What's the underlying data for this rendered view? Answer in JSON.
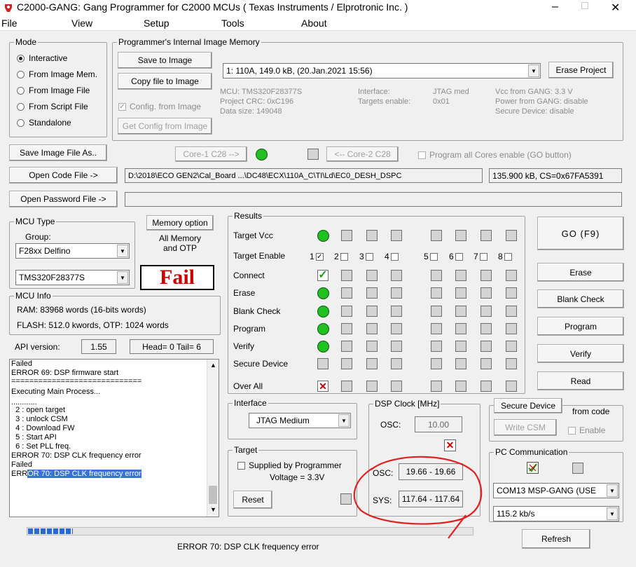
{
  "window": {
    "title": "C2000-GANG:  Gang Programmer for C2000  MCUs ( Texas Instruments / Elprotronic Inc. )",
    "min": "–",
    "max": "□",
    "close": "✕"
  },
  "menu": [
    "File",
    "View",
    "Setup",
    "Tools",
    "About"
  ],
  "mode": {
    "legend": "Mode",
    "options": [
      "Interactive",
      "From Image Mem.",
      "From Image File",
      "From Script File",
      "Standalone"
    ],
    "selected": 0
  },
  "image_memory": {
    "legend": "Programmer's Internal Image Memory",
    "save_to_image": "Save to Image",
    "copy_file": "Copy file to Image",
    "config_from_image": "Config. from Image",
    "get_config": "Get Config from Image",
    "selected_image": "1: 110A, 149.0 kB,  (20.Jan.2021  15:56)",
    "erase_project": "Erase Project",
    "info": [
      [
        "MCU:  TMS320F28377S",
        "Interface:",
        "JTAG med",
        "Vcc from GANG:   3.3 V"
      ],
      [
        "Project CRC: 0xC196",
        "Targets enable:",
        "0x01",
        "Power from GANG:  disable"
      ],
      [
        "Data size:    149048",
        "",
        "",
        "Secure Device:     disable"
      ]
    ]
  },
  "save_image_file": "Save Image File As..",
  "core1": "Core-1 C28 -->",
  "core2": "<-- Core-2 C28",
  "program_all_cores": "Program all Cores enable (GO button)",
  "open_code_file": "Open Code File ->",
  "code_path": "D:\\2018\\ECO GEN2\\Cal_Board ...\\DC48\\ECX\\110A_C\\TI\\Ld\\EC0_DESH_DSPC",
  "code_info": "135.900 kB, CS=0x67FA5391",
  "open_password_file": "Open Password File ->",
  "mcu_type": {
    "legend": "MCU Type",
    "group_label": "Group:",
    "group": "F28xx Delfino",
    "device": "TMS320F28377S"
  },
  "memory_option": {
    "button": "Memory option",
    "line1": "All Memory",
    "line2": "and OTP"
  },
  "fail": "Fail",
  "mcu_info": {
    "legend": "MCU Info",
    "ram": "RAM: 83968 words (16-bits words)",
    "flash": "FLASH: 512.0 kwords,  OTP: 1024 words"
  },
  "api_label": "API version:",
  "api_version": "1.55",
  "head_tail": "Head= 0  Tail= 6",
  "log": [
    "Failed",
    "ERROR 69: DSP firmware start",
    "=============================",
    "Executing Main Process...",
    "............",
    "  2 : open target",
    "  3 : unlock CSM",
    "  4 : Download FW",
    "  5 : Start API",
    "  6 : Set PLL freq.",
    "ERROR 70: DSP CLK frequency error",
    "Failed"
  ],
  "log_last_prefix": "ERR",
  "log_last_selected": "OR 70: DSP CLK frequency error",
  "results": {
    "legend": "Results",
    "rows": [
      "Target Vcc",
      "Target Enable",
      "Connect",
      "Erase",
      "Blank Check",
      "Program",
      "Verify",
      "Secure Device",
      "Over All"
    ],
    "target_numbers": [
      "1",
      "2",
      "3",
      "4",
      "5",
      "6",
      "7",
      "8"
    ]
  },
  "go": "GO  (F9)",
  "erase": "Erase",
  "blank_check": "Blank Check",
  "program": "Program",
  "verify": "Verify",
  "read": "Read",
  "interface": {
    "legend": "Interface",
    "value": "JTAG Medium"
  },
  "target": {
    "legend": "Target",
    "supplied": "Supplied by Programmer",
    "voltage": "Voltage = 3.3V",
    "reset": "Reset"
  },
  "dsp_clock": {
    "legend": "DSP Clock [MHz]",
    "osc_label": "OSC:",
    "osc": "10.00",
    "osc_meas_label": "OSC:",
    "osc_meas": "19.66 - 19.66",
    "sys_label": "SYS:",
    "sys": "117.64 - 117.64"
  },
  "secure": {
    "button": "Secure Device",
    "from_code": "from code",
    "write_csm": "Write CSM",
    "enable": "Enable"
  },
  "pc_comm": {
    "legend": "PC Communication",
    "port": "COM13  MSP-GANG (USE",
    "baud": "115.2 kb/s",
    "refresh": "Refresh"
  },
  "status": "ERROR 70: DSP CLK frequency error",
  "progress": 0.1,
  "colors": {
    "green": "#22c022",
    "red": "#cc0000",
    "highlight": "#3874d8",
    "annotation": "#e02020"
  }
}
